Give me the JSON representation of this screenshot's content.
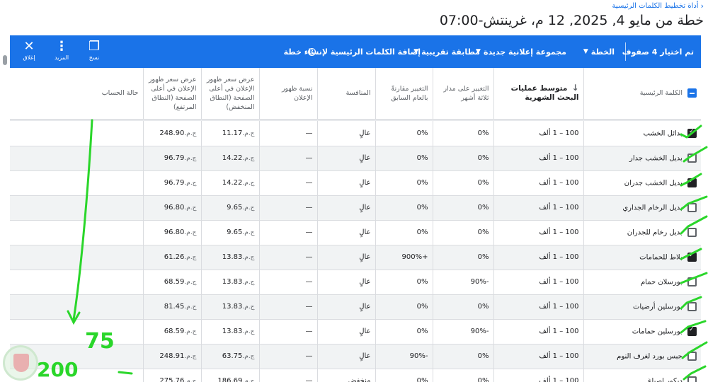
{
  "breadcrumb": {
    "label": "أداة تخطيط الكلمات الرئيسية"
  },
  "page_title": "خطة من مايو 4, 2025, 12 م، غرينتش-07:00",
  "toolbar": {
    "selected": "تم اختيار 4 صفوف",
    "plan": "الخطة",
    "new_ad_group": "مجموعة إعلانية جديدة",
    "match_type": "مطابقة تقريبية",
    "add_keywords": "إضافة الكلمات الرئيسية لإنشاء خطة",
    "copy": "نسخ",
    "more": "المزيد",
    "close": "إغلاق"
  },
  "table": {
    "headers": {
      "keyword": "الكلمة الرئيسية",
      "avg_searches": "متوسط عمليات البحث الشهرية",
      "three_month": "التغيير على مدار ثلاثة أشهر",
      "yoy": "التغيير مقارنةً بالعام السابق",
      "competition": "المنافسة",
      "impression_share": "نسبة ظهور الإعلان",
      "bid_low": "عرض سعر ظهور الإعلان في أعلى الصفحة (النطاق المنخفض)",
      "bid_high": "عرض سعر ظهور الإعلان في أعلى الصفحة (النطاق المرتفع)",
      "account_status": "حالة الحساب"
    },
    "currency": "ج.م.",
    "rows": [
      {
        "keyword": "بدائل الخشب",
        "checked": true,
        "searches": "100 – 1 ألف",
        "three_month": "0%",
        "yoy": "0%",
        "competition": "عالٍ",
        "share": "—",
        "low": "11.17",
        "high": "248.90"
      },
      {
        "keyword": "بديل الخشب جدار",
        "checked": false,
        "searches": "100 – 1 ألف",
        "three_month": "0%",
        "yoy": "0%",
        "competition": "عالٍ",
        "share": "—",
        "low": "14.22",
        "high": "96.79"
      },
      {
        "keyword": "بديل الخشب جدران",
        "checked": true,
        "searches": "100 – 1 ألف",
        "three_month": "0%",
        "yoy": "0%",
        "competition": "عالٍ",
        "share": "—",
        "low": "14.22",
        "high": "96.79"
      },
      {
        "keyword": "بديل الرخام الجداري",
        "checked": false,
        "searches": "100 – 1 ألف",
        "three_month": "0%",
        "yoy": "0%",
        "competition": "عالٍ",
        "share": "—",
        "low": "9.65",
        "high": "96.80"
      },
      {
        "keyword": "بديل رخام للجدران",
        "checked": false,
        "searches": "100 – 1 ألف",
        "three_month": "0%",
        "yoy": "0%",
        "competition": "عالٍ",
        "share": "—",
        "low": "9.65",
        "high": "96.80"
      },
      {
        "keyword": "بلاط للحمامات",
        "checked": true,
        "searches": "100 – 1 ألف",
        "three_month": "0%",
        "yoy": "+900%",
        "competition": "عالٍ",
        "share": "—",
        "low": "13.83",
        "high": "61.26"
      },
      {
        "keyword": "بورسلان حمام",
        "checked": false,
        "searches": "100 – 1 ألف",
        "three_month": "-90%",
        "yoy": "0%",
        "competition": "عالٍ",
        "share": "—",
        "low": "13.83",
        "high": "68.59"
      },
      {
        "keyword": "بورسلين أرضيات",
        "checked": false,
        "searches": "100 – 1 ألف",
        "three_month": "0%",
        "yoy": "0%",
        "competition": "عالٍ",
        "share": "—",
        "low": "13.83",
        "high": "81.45"
      },
      {
        "keyword": "بورسلين حمامات",
        "checked": true,
        "searches": "100 – 1 ألف",
        "three_month": "-90%",
        "yoy": "0%",
        "competition": "عالٍ",
        "share": "—",
        "low": "13.83",
        "high": "68.59"
      },
      {
        "keyword": "جبس بورد لغرف النوم",
        "checked": false,
        "searches": "100 – 1 ألف",
        "three_month": "0%",
        "yoy": "-90%",
        "competition": "عالٍ",
        "share": "—",
        "low": "63.75",
        "high": "248.91"
      },
      {
        "keyword": "ديكور اصباغ",
        "checked": false,
        "searches": "100 – 1 ألف",
        "three_month": "0%",
        "yoy": "0%",
        "competition": "منخفض",
        "share": "—",
        "low": "186.69",
        "high": "275.76"
      }
    ]
  },
  "annotations": {
    "note_a": "75",
    "note_b": "200"
  }
}
